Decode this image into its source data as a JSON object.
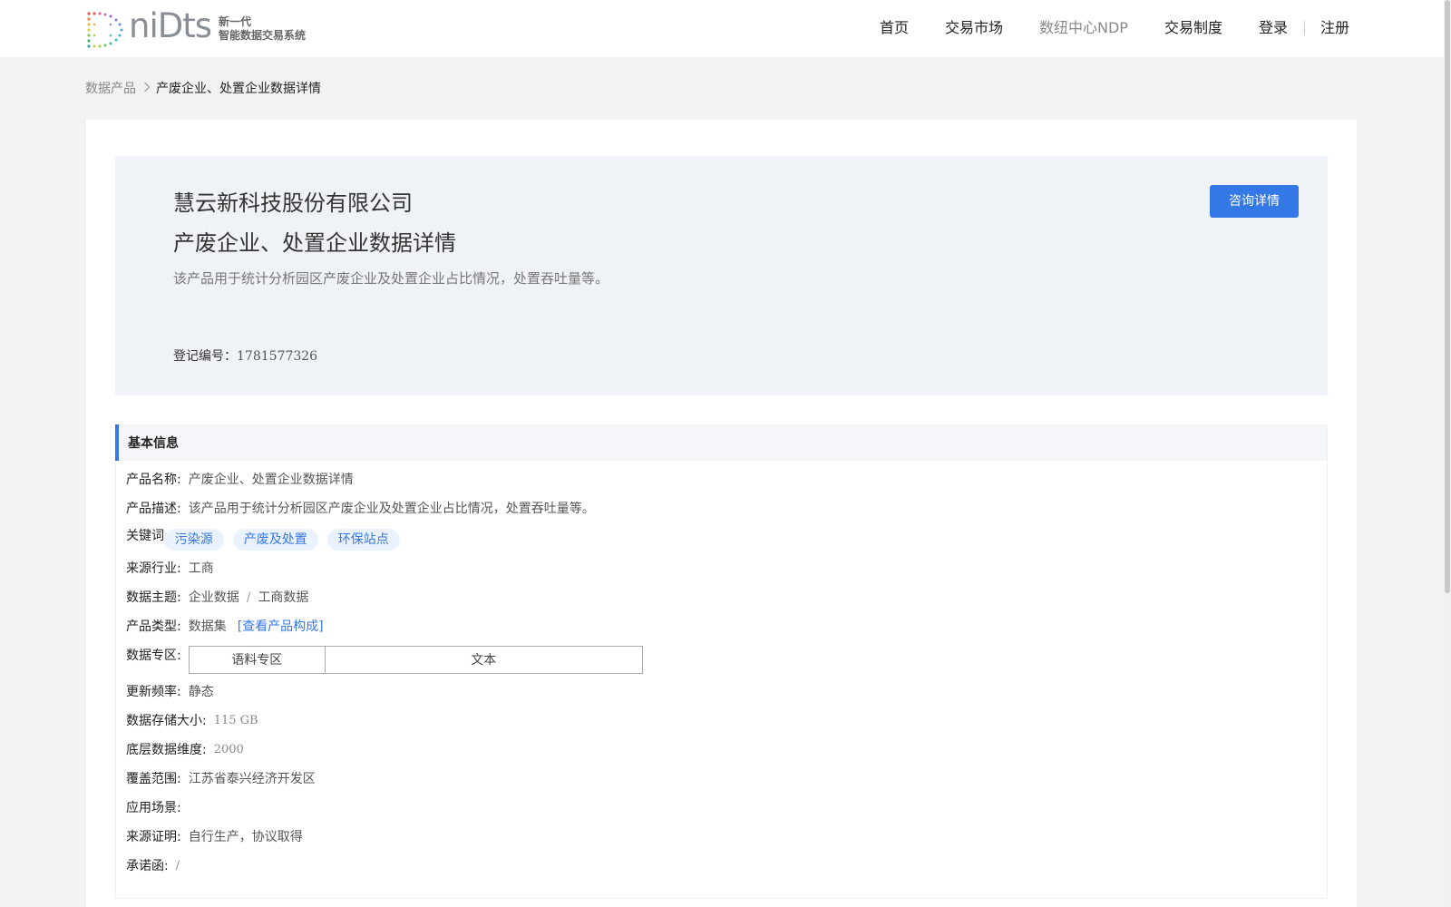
{
  "header": {
    "logo_word": "niDts",
    "logo_sub_line1": "新一代",
    "logo_sub_line2": "智能数据交易系统",
    "nav": [
      "首页",
      "交易市场",
      "数纽中心NDP",
      "交易制度"
    ],
    "login": "登录",
    "register": "注册"
  },
  "breadcrumb": {
    "parent": "数据产品",
    "current": "产废企业、处置企业数据详情"
  },
  "hero": {
    "company": "慧云新科技股份有限公司",
    "title": "产废企业、处置企业数据详情",
    "description": "该产品用于统计分析园区产废企业及处置企业占比情况，处置吞吐量等。",
    "reg_label": "登记编号：",
    "reg_value": "1781577326",
    "consult_button": "咨询详情"
  },
  "basic_info": {
    "heading": "基本信息",
    "product_name_label": "产品名称",
    "product_name": "产废企业、处置企业数据详情",
    "product_desc_label": "产品描述",
    "product_desc": "该产品用于统计分析园区产废企业及处置企业占比情况，处置吞吐量等。",
    "keywords_label": "关键词",
    "keywords": [
      "污染源",
      "产废及处置",
      "环保站点"
    ],
    "industry_label": "来源行业",
    "industry": "工商",
    "theme_label": "数据主题",
    "theme_primary": "企业数据",
    "theme_secondary": "工商数据",
    "type_label": "产品类型",
    "type": "数据集",
    "type_link": "[查看产品构成]",
    "zone_label": "数据专区",
    "zone_name": "语料专区",
    "zone_value": "文本",
    "frequency_label": "更新频率",
    "frequency": "静态",
    "storage_label": "数据存储大小",
    "storage": "115 GB",
    "dimension_label": "底层数据维度",
    "dimension": "2000",
    "coverage_label": "覆盖范围",
    "coverage": "江苏省泰兴经济开发区",
    "scenario_label": "应用场景",
    "scenario": "",
    "proof_label": "来源证明",
    "proof": "自行生产，协议取得",
    "commitment_label": "承诺函",
    "commitment": "/"
  },
  "colors": {
    "accent": "#3478e6",
    "hero_bg": "#eff2f6",
    "page_bg": "#f2f2f2"
  }
}
